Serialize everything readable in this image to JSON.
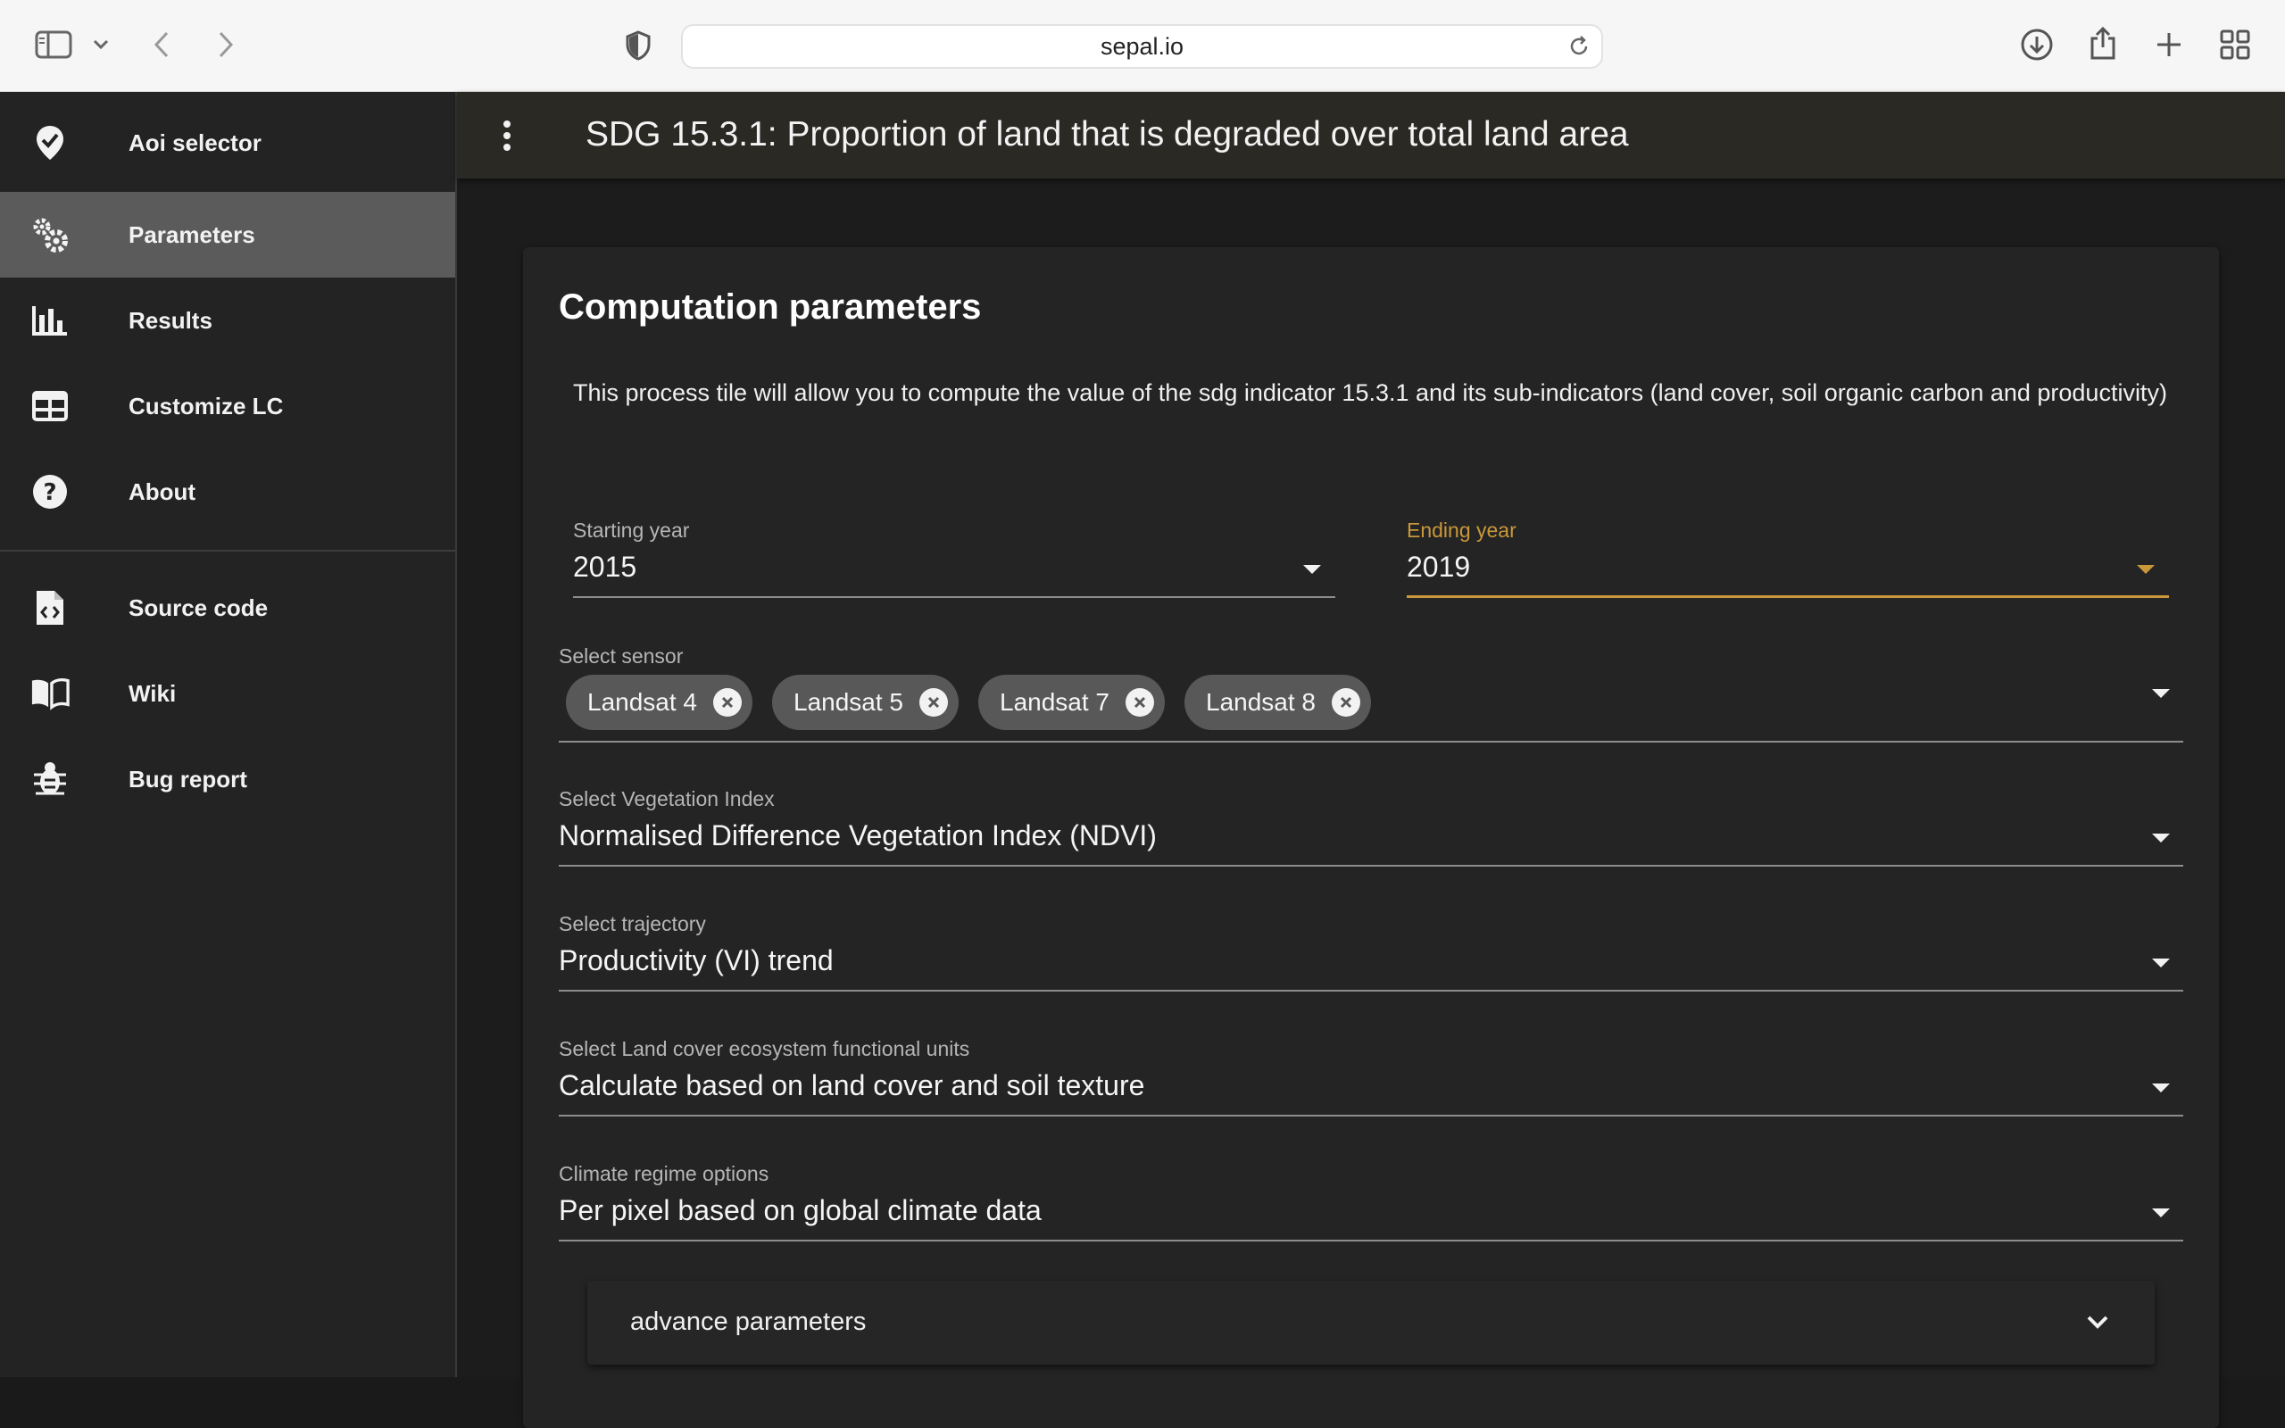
{
  "browser": {
    "url": "sepal.io"
  },
  "sidebar": {
    "items": [
      {
        "label": "Aoi selector",
        "icon": "map-marker-check-icon",
        "active": false
      },
      {
        "label": "Parameters",
        "icon": "gears-icon",
        "active": true
      },
      {
        "label": "Results",
        "icon": "bar-chart-icon",
        "active": false
      },
      {
        "label": "Customize LC",
        "icon": "table-icon",
        "active": false
      },
      {
        "label": "About",
        "icon": "question-circle-icon",
        "active": false
      }
    ],
    "links": [
      {
        "label": "Source code",
        "icon": "file-code-icon"
      },
      {
        "label": "Wiki",
        "icon": "book-open-icon"
      },
      {
        "label": "Bug report",
        "icon": "bug-icon"
      }
    ]
  },
  "app_bar": {
    "title": "SDG 15.3.1: Proportion of land that is degraded over total land area"
  },
  "card": {
    "title": "Computation parameters",
    "description": "This process tile will allow you to compute the value of the sdg indicator 15.3.1 and its sub-indicators (land cover, soil organic carbon and productivity)",
    "starting_year": {
      "label": "Starting year",
      "value": "2015"
    },
    "ending_year": {
      "label": "Ending year",
      "value": "2019"
    },
    "sensor": {
      "label": "Select sensor",
      "chips": [
        "Landsat 4",
        "Landsat 5",
        "Landsat 7",
        "Landsat 8"
      ]
    },
    "vegetation_index": {
      "label": "Select Vegetation Index",
      "value": "Normalised Difference Vegetation Index (NDVI)"
    },
    "trajectory": {
      "label": "Select trajectory",
      "value": "Productivity (VI) trend"
    },
    "land_cover_units": {
      "label": "Select Land cover ecosystem functional units",
      "value": "Calculate based on land cover and soil texture"
    },
    "climate_regime": {
      "label": "Climate regime options",
      "value": "Per pixel based on global climate data"
    },
    "advanced": {
      "label": "advance parameters"
    }
  },
  "colors": {
    "accent": "#c9983a",
    "sidebar_bg": "#232323",
    "active_item_bg": "#5b5b5b",
    "card_bg": "#242424",
    "chip_bg": "#585858"
  }
}
